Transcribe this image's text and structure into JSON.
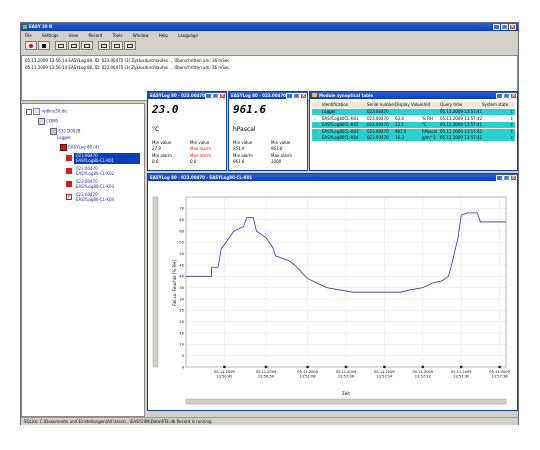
{
  "window": {
    "title": "EASY 20 N",
    "title_bg": "#0a3fb8"
  },
  "menu": [
    "File",
    "Settings",
    "View",
    "Record",
    "Tools",
    "Window",
    "Help",
    "Language"
  ],
  "log_lines": [
    "05.11.2009 13:56:14 EASYLog 80, ID: 023.00470 (3) Zyklusdurchlaufes ... Überschritten um: 36 mSec",
    "05.11.2009 13:56:14 EASYLog 80, ID: 023.00470 (3) Zyklusdurchlaufes ... Überschritten um: 36 mSec"
  ],
  "tree": {
    "root": "redline50.dic",
    "com": "COM5",
    "device": "S32 D0028",
    "device_sub": "Logger",
    "logger": "EASYLog 80 (4)",
    "channels": [
      {
        "id": "023.00470",
        "name": "EASYLog80-CL-K01"
      },
      {
        "id": "023.00470",
        "name": "EASYLog80-CL-K02"
      },
      {
        "id": "023.00470",
        "name": "EASYLog80-CL-K03"
      },
      {
        "id": "023.00470",
        "name": "EASYLog80-CL-K04"
      }
    ]
  },
  "panel1": {
    "title": "EASYLog 80 - 023.00470 ...",
    "value": "23.0",
    "unit": "°C",
    "min_value_label": "Min value",
    "min_value": "27.9",
    "max_value_label": "Min value",
    "max_value": "Max alarm",
    "min_alarm_label": "Min alarm",
    "min_alarm": "0.0",
    "max_alarm_label": "Max alarm",
    "max_alarm": "0.0"
  },
  "panel2": {
    "title": "EASYLog 80 - 023.00470 ...",
    "value": "961.6",
    "unit": "hPascal",
    "min_value_label": "Min value",
    "min_value": "951.9",
    "max_value_label": "Min value",
    "max_value": "961.6",
    "min_alarm_label": "Min alarm",
    "min_alarm": "961.6",
    "max_alarm_label": "Max alarm",
    "max_alarm": "1000"
  },
  "table_panel": {
    "title": "Module synoptical table",
    "headers": [
      "Identification",
      "Serial number",
      "Display Value",
      "Unit",
      "Query time",
      "System state"
    ],
    "rows": [
      {
        "id": "Logger",
        "serial": "023.00470",
        "value": "",
        "unit": "",
        "time": "05.11.2009 13:57:41",
        "state": "",
        "bg": "#2ad0d0",
        "warn": true
      },
      {
        "id": "EASYLog80CL-K01",
        "serial": "023.00470",
        "value": "63.4",
        "unit": "% RH",
        "time": "05.11.2009 13:57:42",
        "state": "",
        "bg": "#ffffff",
        "warn": false
      },
      {
        "id": "EASYLog80CL-K02",
        "serial": "023.00470",
        "value": "23.1",
        "unit": "°C",
        "time": "05.11.2009 13:57:41",
        "state": "",
        "bg": "#2ad0d0",
        "warn": false
      },
      {
        "id": "EASYLog80CL-K03",
        "serial": "023.00470",
        "value": "961.6",
        "unit": "hPascal",
        "time": "05.11.2009 13:57:41",
        "state": "",
        "bg": "#2ad0d0",
        "warn": false
      },
      {
        "id": "EASYLog80CL-K04",
        "serial": "023.00470",
        "value": "16.3",
        "unit": "g/m^3",
        "time": "05.11.2009 13:57:41",
        "state": "",
        "bg": "#2ad0d0",
        "warn": false
      }
    ]
  },
  "chart_panel": {
    "title": "EASYLog 80 - 023.00470 - EASYLog80-CL-K01"
  },
  "chart_data": {
    "type": "line",
    "title": "",
    "xlabel": "Zeit",
    "ylabel": "Rel.Lu. Feuchte [% RH]",
    "ylim": [
      0,
      75
    ],
    "yticks": [
      0,
      5,
      10,
      15,
      20,
      25,
      30,
      35,
      40,
      45,
      50,
      55,
      60,
      65,
      70
    ],
    "xticks": [
      {
        "t": 0.12,
        "label": [
          "05.11.2009",
          "13:50:42"
        ]
      },
      {
        "t": 0.25,
        "label": [
          "05.11.2009",
          "13:50:50"
        ]
      },
      {
        "t": 0.38,
        "label": [
          "05.11.2009",
          "13:51:08"
        ]
      },
      {
        "t": 0.5,
        "label": [
          "05.11.2009",
          "13:57:06"
        ]
      },
      {
        "t": 0.62,
        "label": [
          "05.11.2009",
          "13:57:14"
        ]
      },
      {
        "t": 0.74,
        "label": [
          "05.11.2009",
          "13:57:22"
        ]
      },
      {
        "t": 0.86,
        "label": [
          "05.11.2009",
          "13:57:30"
        ]
      },
      {
        "t": 0.98,
        "label": [
          "05.11.2009",
          "13:57:38"
        ]
      }
    ],
    "series": [
      {
        "color": "#3333aa",
        "points": [
          [
            0.0,
            40
          ],
          [
            0.08,
            40
          ],
          [
            0.08,
            44
          ],
          [
            0.1,
            44
          ],
          [
            0.11,
            52
          ],
          [
            0.15,
            60
          ],
          [
            0.18,
            62
          ],
          [
            0.19,
            66
          ],
          [
            0.21,
            66
          ],
          [
            0.22,
            60
          ],
          [
            0.25,
            57
          ],
          [
            0.27,
            53
          ],
          [
            0.28,
            49
          ],
          [
            0.32,
            47
          ],
          [
            0.34,
            45
          ],
          [
            0.36,
            42
          ],
          [
            0.38,
            39
          ],
          [
            0.41,
            37
          ],
          [
            0.44,
            35
          ],
          [
            0.48,
            34
          ],
          [
            0.52,
            33
          ],
          [
            0.56,
            33
          ],
          [
            0.6,
            33
          ],
          [
            0.64,
            33
          ],
          [
            0.67,
            33
          ],
          [
            0.7,
            34
          ],
          [
            0.74,
            35
          ],
          [
            0.77,
            37
          ],
          [
            0.8,
            38
          ],
          [
            0.82,
            40
          ],
          [
            0.83,
            45
          ],
          [
            0.85,
            57
          ],
          [
            0.86,
            67
          ],
          [
            0.88,
            68
          ],
          [
            0.91,
            68
          ],
          [
            0.92,
            64
          ],
          [
            0.96,
            64
          ],
          [
            1.0,
            64
          ]
        ]
      }
    ]
  },
  "status": "SQLite: C:\\Dokumente und Einstellungen\\All Users\\...\\EASY20N\\Data\\RTE.db   Record is running"
}
